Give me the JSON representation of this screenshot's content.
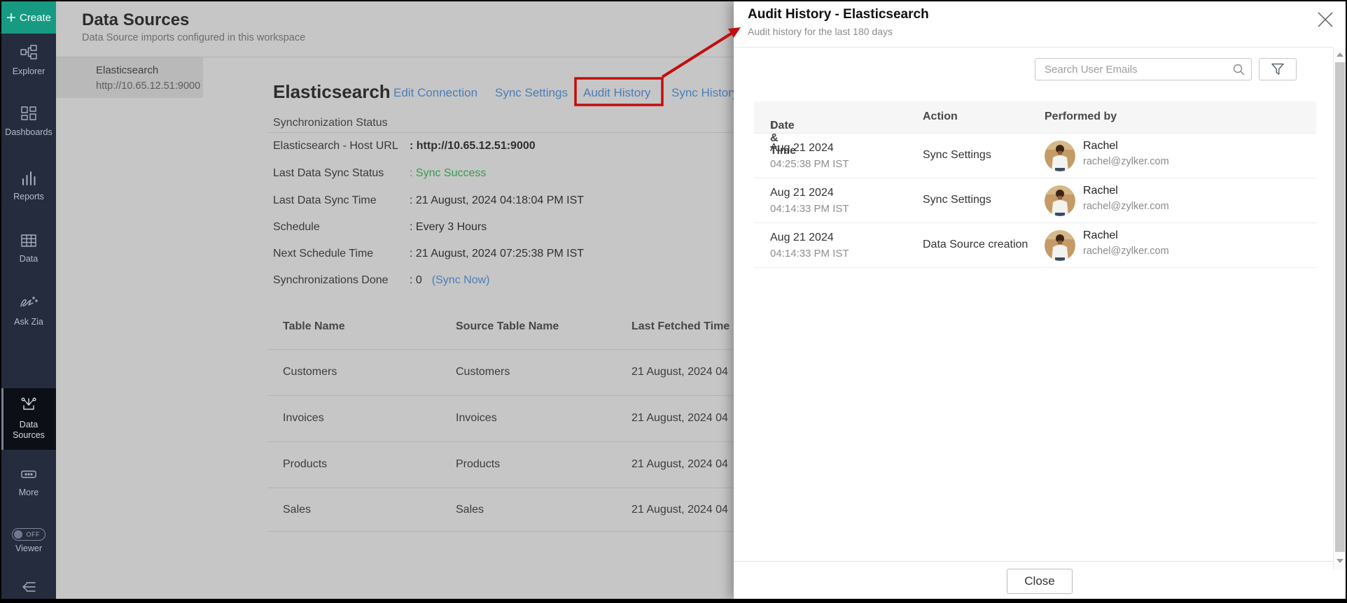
{
  "colors": {
    "accent_teal": "#169a82",
    "link_blue": "#4b7db7",
    "success_green": "#3b9a50",
    "annotation_red": "#c40d0d",
    "sidebar_bg": "#252c3d"
  },
  "sidebar": {
    "create_label": "Create",
    "items": [
      {
        "label": "Explorer"
      },
      {
        "label": "Dashboards"
      },
      {
        "label": "Reports"
      },
      {
        "label": "Data"
      },
      {
        "label": "Ask Zia"
      },
      {
        "label": "Data Sources",
        "active": true
      },
      {
        "label": "More"
      }
    ],
    "viewer": {
      "label": "Viewer",
      "toggle_state": "OFF"
    }
  },
  "header": {
    "title": "Data Sources",
    "subtitle": "Data Source imports configured in this workspace"
  },
  "source_list": {
    "selected": {
      "name": "Elasticsearch",
      "url": "http://10.65.12.51:9000"
    }
  },
  "detail": {
    "title": "Elasticsearch",
    "links": [
      {
        "label": "Edit Connection"
      },
      {
        "label": "Sync Settings"
      },
      {
        "label": "Audit History",
        "highlighted": true
      },
      {
        "label": "Sync History"
      }
    ],
    "section_label": "Synchronization Status",
    "fields": [
      {
        "label": "Elasticsearch - Host URL",
        "value": ": http://10.65.12.51:9000"
      },
      {
        "label": "Last Data Sync Status",
        "value": ": Sync Success"
      },
      {
        "label": "Last Data Sync Time",
        "value": ": 21 August, 2024 04:18:04 PM IST"
      },
      {
        "label": "Schedule",
        "value": ": Every 3 Hours"
      },
      {
        "label": "Next Schedule Time",
        "value": ": 21 August, 2024 07:25:38 PM IST"
      },
      {
        "label": "Synchronizations Done",
        "value": ": 0",
        "link": "(Sync Now)"
      }
    ],
    "tables": {
      "columns": [
        "Table Name",
        "Source Table Name",
        "Last Fetched Time"
      ],
      "rows": [
        {
          "name": "Customers",
          "source": "Customers",
          "fetched": "21 August, 2024 04"
        },
        {
          "name": "Invoices",
          "source": "Invoices",
          "fetched": "21 August, 2024 04"
        },
        {
          "name": "Products",
          "source": "Products",
          "fetched": "21 August, 2024 04"
        },
        {
          "name": "Sales",
          "source": "Sales",
          "fetched": "21 August, 2024 04"
        }
      ]
    }
  },
  "panel": {
    "title": "Audit History - Elasticsearch",
    "subtitle": "Audit history for the last 180 days",
    "search_placeholder": "Search User Emails",
    "columns": {
      "datetime": "Date & Time",
      "sort_icon": "↓",
      "action": "Action",
      "performed_by": "Performed by"
    },
    "rows": [
      {
        "date": "Aug 21 2024",
        "time": "04:25:38 PM IST",
        "action": "Sync Settings",
        "user": "Rachel",
        "email": "rachel@zylker.com"
      },
      {
        "date": "Aug 21 2024",
        "time": "04:14:33 PM IST",
        "action": "Sync Settings",
        "user": "Rachel",
        "email": "rachel@zylker.com"
      },
      {
        "date": "Aug 21 2024",
        "time": "04:14:33 PM IST",
        "action": "Data Source creation",
        "user": "Rachel",
        "email": "rachel@zylker.com"
      }
    ],
    "close_label": "Close"
  }
}
